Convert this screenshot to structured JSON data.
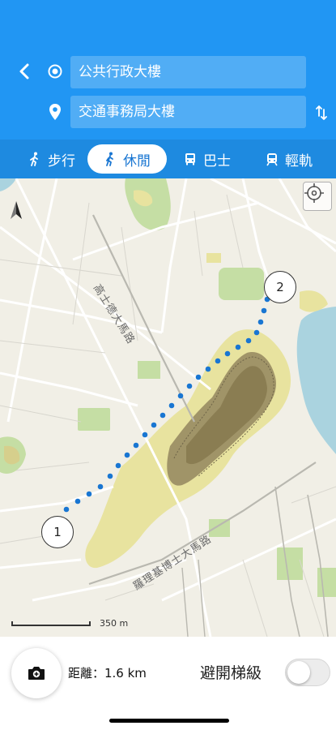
{
  "route": {
    "origin_value": "公共行政大樓",
    "destination_value": "交通事務局大樓"
  },
  "modes": [
    {
      "label": "步行",
      "icon": "walk-icon",
      "active": false
    },
    {
      "label": "休閒",
      "icon": "walk-leisure-icon",
      "active": true
    },
    {
      "label": "巴士",
      "icon": "bus-icon",
      "active": false
    },
    {
      "label": "輕軌",
      "icon": "light-rail-icon",
      "active": false
    }
  ],
  "map": {
    "street_labels": [
      "高士德大馬路",
      "羅理基博士大馬路"
    ],
    "scale_label": "350 m",
    "markers": [
      "1",
      "2"
    ]
  },
  "footer": {
    "distance_text": "距離：1.6 km",
    "avoid_stairs_label": "避開梯級",
    "avoid_stairs_enabled": false
  },
  "colors": {
    "header_blue": "#2196f3",
    "mode_bar_blue": "#1e8ae0",
    "route_dot_blue": "#1976d2"
  }
}
